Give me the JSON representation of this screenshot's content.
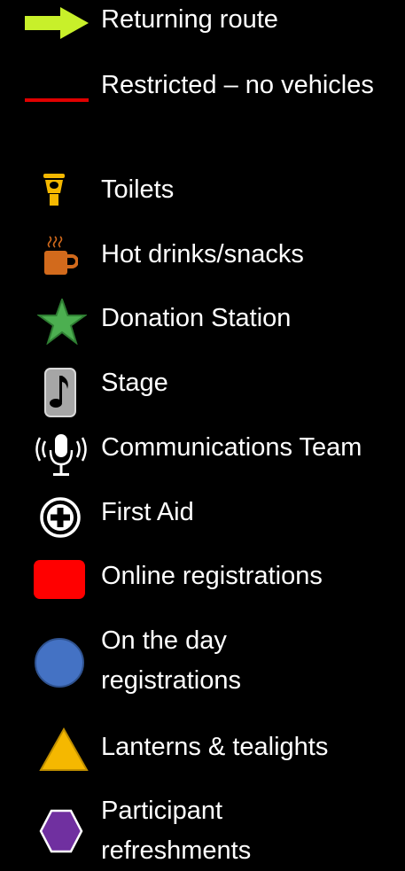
{
  "legend": {
    "items": [
      {
        "key": "returning-route",
        "label": "Returning route",
        "icon": "arrow-right-icon",
        "color": "#c8f02a"
      },
      {
        "key": "restricted",
        "label": "Restricted – no vehicles",
        "icon": "red-line-icon",
        "color": "#e00000"
      },
      {
        "key": "toilets",
        "label": "Toilets",
        "icon": "toilet-icon",
        "color": "#f5b800"
      },
      {
        "key": "hot-drinks",
        "label": "Hot drinks/snacks",
        "icon": "hot-drink-icon",
        "color": "#d26a1c"
      },
      {
        "key": "donation",
        "label": "Donation Station",
        "icon": "star-icon",
        "color": "#4caf50"
      },
      {
        "key": "stage",
        "label": "Stage",
        "icon": "music-note-icon",
        "color": "#9e9e9e"
      },
      {
        "key": "comms",
        "label": "Communications Team",
        "icon": "microphone-icon",
        "color": "#ffffff"
      },
      {
        "key": "first-aid",
        "label": "First Aid",
        "icon": "first-aid-cross-icon",
        "color": "#ffffff"
      },
      {
        "key": "online-reg",
        "label": "Online registrations",
        "icon": "red-rectangle-icon",
        "color": "#ff0000"
      },
      {
        "key": "day-reg",
        "label": "On the day registrations",
        "icon": "blue-circle-icon",
        "color": "#4472c4"
      },
      {
        "key": "lanterns",
        "label": "Lanterns & tealights",
        "icon": "yellow-triangle-icon",
        "color": "#f5b800"
      },
      {
        "key": "refreshments",
        "label": "Participant refreshments",
        "icon": "purple-hexagon-icon",
        "color": "#7030a0"
      }
    ]
  }
}
